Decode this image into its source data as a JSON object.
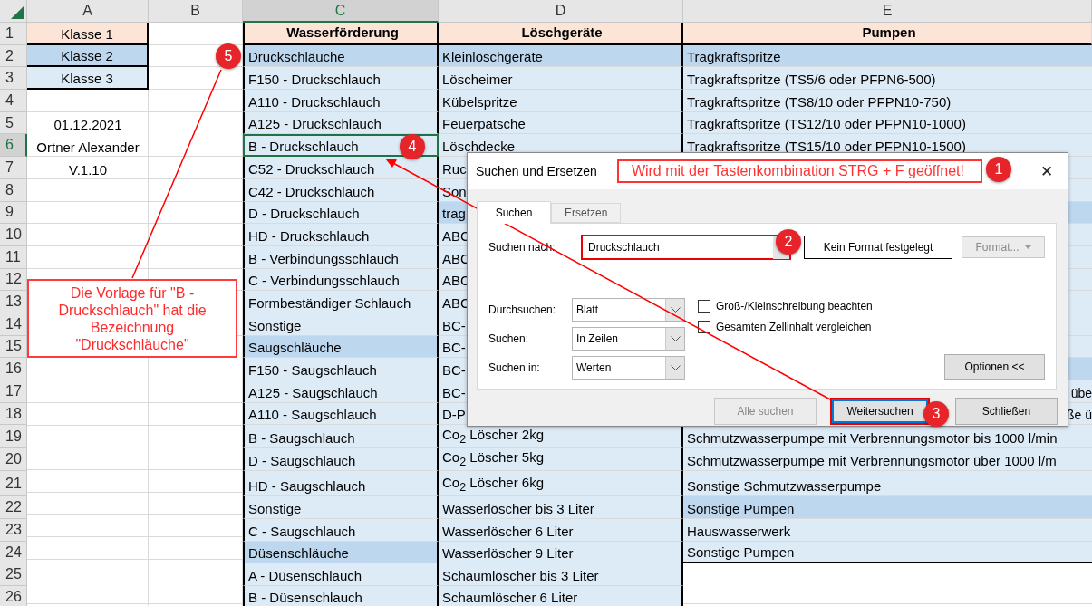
{
  "sheet": {
    "columns": [
      {
        "label": "A",
        "selected": false
      },
      {
        "label": "B",
        "selected": false
      },
      {
        "label": "C",
        "selected": true
      },
      {
        "label": "D",
        "selected": false
      },
      {
        "label": "E",
        "selected": false
      }
    ],
    "rows": [
      {
        "number": "1",
        "selected": false,
        "a": {
          "text": "Klasse 1",
          "kind": "header"
        },
        "c": {
          "text": "Wasserförderung",
          "kind": "title"
        },
        "d": {
          "text": "Löschgeräte",
          "kind": "title"
        },
        "e": {
          "text": "Pumpen",
          "kind": "title"
        }
      },
      {
        "number": "2",
        "selected": false,
        "a": {
          "text": "Klasse 2",
          "kind": "group"
        },
        "c": {
          "text": "Druckschläuche",
          "kind": "group"
        },
        "d": {
          "text": "Kleinlöschgeräte",
          "kind": "group"
        },
        "e": {
          "text": "Tragkraftspritze",
          "kind": "group"
        }
      },
      {
        "number": "3",
        "selected": false,
        "a": {
          "text": "Klasse 3",
          "kind": "item"
        },
        "c": {
          "text": "F150 - Druckschlauch",
          "kind": "item"
        },
        "d": {
          "text": "Löscheimer",
          "kind": "item"
        },
        "e": {
          "text": "Tragkraftspritze (TS5/6 oder PFPN6-500)",
          "kind": "item"
        }
      },
      {
        "number": "4",
        "selected": false,
        "c": {
          "text": "A110 - Druckschlauch",
          "kind": "item"
        },
        "d": {
          "text": "Kübelspritze",
          "kind": "item"
        },
        "e": {
          "text": "Tragkraftspritze (TS8/10 oder PFPN10-750)",
          "kind": "item"
        }
      },
      {
        "number": "5",
        "selected": false,
        "a": {
          "text": "01.12.2021"
        },
        "c": {
          "text": "A125 - Druckschlauch",
          "kind": "item"
        },
        "d": {
          "text": "Feuerpatsche",
          "kind": "item"
        },
        "e": {
          "text": "Tragkraftspritze (TS12/10 oder PFPN10-1000)",
          "kind": "item"
        }
      },
      {
        "number": "6",
        "selected": true,
        "a": {
          "text": "Ortner Alexander"
        },
        "c": {
          "text": "B - Druckschlauch",
          "kind": "item"
        },
        "d": {
          "text": "Löschdecke",
          "kind": "item"
        },
        "e": {
          "text": "Tragkraftspritze (TS15/10 oder PFPN10-1500)",
          "kind": "item"
        }
      },
      {
        "number": "7",
        "selected": false,
        "a": {
          "text": "V.1.10"
        },
        "c": {
          "text": "C52 - Druckschlauch",
          "kind": "item"
        },
        "d": {
          "text": "Ruc",
          "kind": "item"
        },
        "e": {
          "kind": "item"
        }
      },
      {
        "number": "8",
        "selected": false,
        "c": {
          "text": "C42 - Druckschlauch",
          "kind": "item"
        },
        "d": {
          "text": "Son",
          "kind": "item"
        },
        "e": {
          "kind": "item"
        }
      },
      {
        "number": "9",
        "selected": false,
        "c": {
          "text": "D - Druckschlauch",
          "kind": "item"
        },
        "d": {
          "text": "trag",
          "kind": "group"
        },
        "e": {
          "kind": "group"
        }
      },
      {
        "number": "10",
        "selected": false,
        "c": {
          "text": "HD - Druckschlauch",
          "kind": "item"
        },
        "d": {
          "text": "ABC",
          "kind": "item"
        },
        "e": {
          "kind": "item"
        }
      },
      {
        "number": "11",
        "selected": false,
        "c": {
          "text": "B - Verbindungsschlauch",
          "kind": "item"
        },
        "d": {
          "text": "ABC",
          "kind": "item"
        },
        "e": {
          "kind": "item"
        }
      },
      {
        "number": "12",
        "selected": false,
        "c": {
          "text": "C - Verbindungsschlauch",
          "kind": "item"
        },
        "d": {
          "text": "ABC",
          "kind": "item"
        },
        "e": {
          "kind": "item"
        }
      },
      {
        "number": "13",
        "selected": false,
        "c": {
          "text": "Formbeständiger Schlauch",
          "kind": "item"
        },
        "d": {
          "text": "ABC",
          "kind": "item"
        },
        "e": {
          "kind": "item"
        }
      },
      {
        "number": "14",
        "selected": false,
        "c": {
          "text": "Sonstige",
          "kind": "item"
        },
        "d": {
          "text": "BC-",
          "kind": "item"
        },
        "e": {
          "kind": "item"
        }
      },
      {
        "number": "15",
        "selected": false,
        "c": {
          "text": "Saugschläuche",
          "kind": "group"
        },
        "d": {
          "text": "BC-",
          "kind": "item"
        },
        "e": {
          "kind": "item"
        }
      },
      {
        "number": "16",
        "selected": false,
        "c": {
          "text": "F150 - Saugschlauch",
          "kind": "item"
        },
        "d": {
          "text": "BC-",
          "kind": "item"
        },
        "e": {
          "kind": "group"
        }
      },
      {
        "number": "17",
        "selected": false,
        "c": {
          "text": "A125 - Saugschlauch",
          "kind": "item"
        },
        "d": {
          "text": "BC-",
          "kind": "item"
        },
        "e": {
          "text": "übe",
          "kind": "item",
          "cut": true
        }
      },
      {
        "number": "18",
        "selected": false,
        "c": {
          "text": "A110 - Saugschlauch",
          "kind": "item"
        },
        "d": {
          "text": "D-P",
          "kind": "item"
        },
        "e": {
          "text": "ße ü",
          "kind": "item",
          "cut": true
        }
      },
      {
        "number": "19",
        "selected": false,
        "c": {
          "text": "B - Saugschlauch",
          "kind": "item"
        },
        "d": {
          "text": "Co$_{2}$ Löscher 2kg",
          "kind": "item"
        },
        "e": {
          "text": "Schmutzwasserpumpe mit Verbrennungsmotor bis 1000 l/min",
          "kind": "item"
        }
      },
      {
        "number": "20",
        "selected": false,
        "c": {
          "text": "D - Saugschlauch",
          "kind": "item"
        },
        "d": {
          "text": "Co$_{2}$ Löscher 5kg",
          "kind": "item"
        },
        "e": {
          "text": "Schmutzwasserpumpe mit Verbrennungsmotor  über 1000 l/m",
          "kind": "item"
        }
      },
      {
        "number": "21",
        "selected": false,
        "c": {
          "text": "HD - Saugschlauch",
          "kind": "item"
        },
        "d": {
          "text": "Co$_{2}$ Löscher 6kg",
          "kind": "item"
        },
        "e": {
          "text": "Sonstige Schmutzwasserpumpe",
          "kind": "item"
        }
      },
      {
        "number": "22",
        "selected": false,
        "c": {
          "text": "Sonstige",
          "kind": "item"
        },
        "d": {
          "text": "Wasserlöscher bis 3 Liter",
          "kind": "item"
        },
        "e": {
          "text": "Sonstige Pumpen",
          "kind": "group"
        }
      },
      {
        "number": "23",
        "selected": false,
        "c": {
          "text": "C - Saugschlauch",
          "kind": "item"
        },
        "d": {
          "text": "Wasserlöscher 6 Liter",
          "kind": "item"
        },
        "e": {
          "text": "Hauswasserwerk",
          "kind": "item"
        }
      },
      {
        "number": "24",
        "selected": false,
        "c": {
          "text": "Düsenschläuche",
          "kind": "group"
        },
        "d": {
          "text": "Wasserlöscher 9 Liter",
          "kind": "item"
        },
        "e": {
          "text": "Sonstige Pumpen",
          "kind": "item"
        }
      },
      {
        "number": "25",
        "selected": false,
        "c": {
          "text": "A - Düsenschlauch",
          "kind": "item"
        },
        "d": {
          "text": "Schaumlöscher bis 3 Liter",
          "kind": "item"
        }
      },
      {
        "number": "26",
        "selected": false,
        "c": {
          "text": "B - Düsenschlauch",
          "kind": "item"
        },
        "d": {
          "text": "Schaumlöscher 6 Liter",
          "kind": "item"
        }
      }
    ]
  },
  "callout": {
    "text": "Die Vorlage für \"B - Druckschlauch\" hat die Bezeichnung \"Druckschläuche\""
  },
  "badges": [
    {
      "number": "5"
    },
    {
      "number": "4"
    },
    {
      "number": "1"
    },
    {
      "number": "2"
    },
    {
      "number": "3"
    }
  ],
  "dialog": {
    "title": "Suchen und Ersetzen",
    "note": "Wird mit der Tastenkombination STRG + F geöffnet!",
    "close": "✕",
    "tabs": [
      {
        "label": "Suchen",
        "selected": true
      },
      {
        "label": "Ersetzen",
        "selected": false
      }
    ],
    "find": {
      "label": "Suchen nach:",
      "value": "Druckschlauch",
      "highlighted": true
    },
    "format_status": "Kein Format festgelegt",
    "format_button": {
      "label": "Format...",
      "disabled": true
    },
    "options": [
      {
        "label": "Durchsuchen:",
        "value": "Blatt"
      },
      {
        "label": "Suchen:",
        "value": "In Zeilen"
      },
      {
        "label": "Suchen in:",
        "value": "Werten"
      }
    ],
    "checkboxes": [
      {
        "label": "Groß-/Kleinschreibung beachten",
        "checked": false
      },
      {
        "label": "Gesamten Zellinhalt vergleichen",
        "checked": false
      }
    ],
    "options_button": "Optionen <<",
    "buttons": [
      {
        "label": "Alle suchen",
        "disabled": true,
        "default": false,
        "highlighted": false
      },
      {
        "label": "Weitersuchen",
        "disabled": false,
        "default": true,
        "highlighted": true
      },
      {
        "label": "Schließen",
        "disabled": false,
        "default": false,
        "highlighted": false
      }
    ]
  }
}
